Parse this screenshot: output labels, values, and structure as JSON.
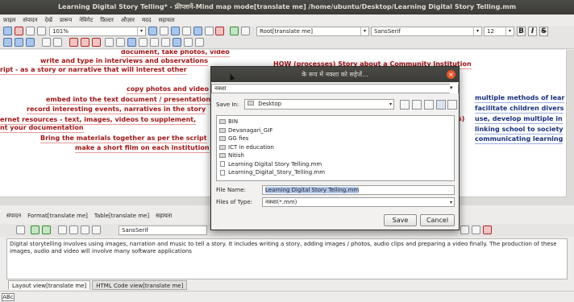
{
  "window": {
    "title": "Learning Digital Story Telling* - फ्रीप्लानें-Mind map mode[translate me] /home/ubuntu/Desktop/Learning Digital Story Telling.mm"
  },
  "menubar": [
    "फ़ाइल",
    "संपादन",
    "देखें",
    "प्रारूप",
    "नेविगेट",
    "फ़िल्टर",
    "औज़ार",
    "मदद",
    "सहायता"
  ],
  "toolbar": {
    "zoom_value": "101%",
    "style_value": "Root[translate me]",
    "font_family": "SansSerif",
    "font_size": "12",
    "bold_label": "B",
    "italic_label": "I",
    "strike_label": "S"
  },
  "mindmap": {
    "left_nodes": [
      "document, take photos, video",
      "write and type in interviews and observations",
      "ript - as a story or narrative that will interest other",
      "copy photos and video",
      "embed into the text document / presentation",
      "record interesting events, narratives in the story",
      "ernet resources - text, images, videos to supplement,",
      "nt your documentation",
      "Bring the materials together as per the script",
      "make a short film on each institution"
    ],
    "center_node": "HOW (processes) Story about a Community Institution",
    "right_nodes": [
      "multiple methods of lear",
      "facilitate children divers",
      "use, develop multiple in",
      "linking school to society",
      "communicating learning"
    ],
    "right_marker": "s)"
  },
  "dialog": {
    "title": "के रूप में नक्शा को सहेजें...",
    "top_field_value": "नक्शा",
    "save_in_label": "Save In:",
    "save_in_value": "Desktop",
    "files": [
      {
        "name": "BIN",
        "kind": "folder"
      },
      {
        "name": "Devanagari_GIF",
        "kind": "folder"
      },
      {
        "name": "GG fies",
        "kind": "folder"
      },
      {
        "name": "ICT in education",
        "kind": "folder"
      },
      {
        "name": "Nitish",
        "kind": "folder"
      },
      {
        "name": "Learning Digital Story Telling.mm",
        "kind": "file"
      },
      {
        "name": "Learning_Digital_Story_Telling.mm",
        "kind": "file"
      }
    ],
    "file_name_label": "File Name:",
    "file_name_value": "Learning Digital Story Telling.mm",
    "files_of_type_label": "Files of Type:",
    "files_of_type_value": "नक्शा(*.mm)",
    "save_button": "Save",
    "cancel_button": "Cancel"
  },
  "lower_panel": {
    "menu": [
      "संपादन",
      "Format[translate me]",
      "Table[translate me]",
      "सहायता"
    ],
    "font_value": "SansSerif",
    "editor_text": "Digital storytelling involves using images, narration and music to tell a story. It includes writing a story, adding images / photos, audio clips and preparing a video finally. The production of these images, audio and video will involve many software applications",
    "tabs": [
      "Layout view[translate me]",
      "HTML Code view[translate me]"
    ]
  },
  "statusbar": {
    "spell_label": "ABc"
  }
}
